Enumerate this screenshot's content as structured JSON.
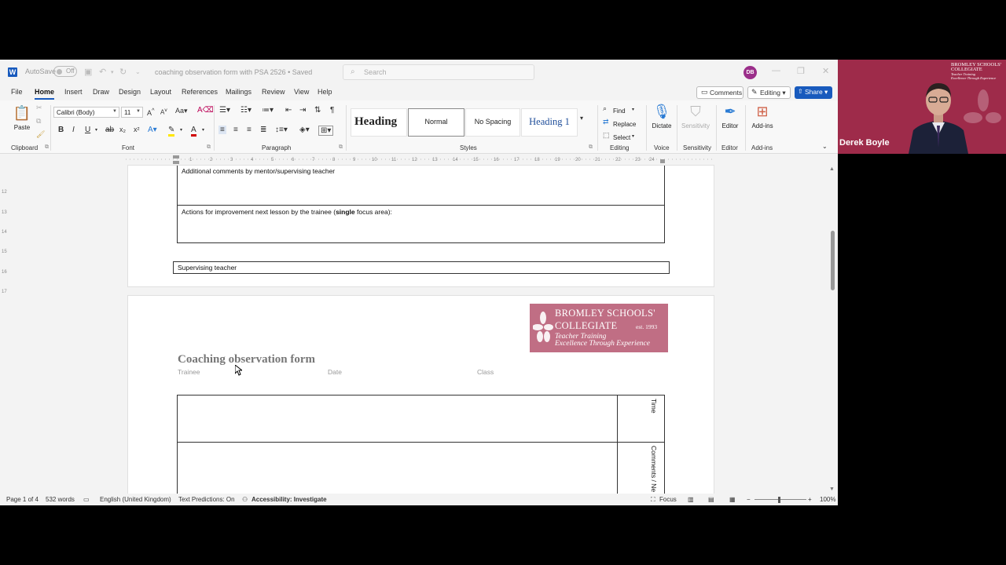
{
  "window": {
    "autosave_label": "AutoSave",
    "autosave_state": "Off",
    "doc_title": "coaching observation form with PSA 2526 • Saved",
    "search_placeholder": "Search",
    "avatar_initials": "DB"
  },
  "menu": {
    "tabs": [
      "File",
      "Home",
      "Insert",
      "Draw",
      "Design",
      "Layout",
      "References",
      "Mailings",
      "Review",
      "View",
      "Help"
    ],
    "active": "Home",
    "comments_label": "Comments",
    "editing_label": "Editing",
    "share_label": "Share"
  },
  "ribbon": {
    "clipboard": {
      "paste_label": "Paste",
      "group_label": "Clipboard"
    },
    "font": {
      "family": "Calibri (Body)",
      "size": "11",
      "group_label": "Font"
    },
    "paragraph": {
      "group_label": "Paragraph"
    },
    "styles": {
      "items": [
        "Heading",
        "Normal",
        "No Spacing",
        "Heading 1"
      ],
      "group_label": "Styles"
    },
    "editing": {
      "find": "Find",
      "replace": "Replace",
      "select": "Select",
      "group_label": "Editing"
    },
    "voice": {
      "dictate": "Dictate",
      "group_label": "Voice"
    },
    "sensitivity": {
      "label": "Sensitivity",
      "group_label": "Sensitivity"
    },
    "editor": {
      "label": "Editor",
      "group_label": "Editor"
    },
    "addins": {
      "label": "Add-ins",
      "group_label": "Add-ins"
    }
  },
  "ruler_ticks": [
    "1",
    "2",
    "3",
    "4",
    "5",
    "6",
    "7",
    "8",
    "9",
    "10",
    "11",
    "12",
    "13",
    "14",
    "15",
    "16",
    "17",
    "18",
    "19",
    "20",
    "21",
    "22",
    "23",
    "24"
  ],
  "vruler_ticks": [
    "12",
    "13",
    "14",
    "15",
    "16",
    "17"
  ],
  "document": {
    "page1": {
      "additional_comments": "Additional comments by mentor/supervising teacher",
      "actions_prefix": "Actions for improvement next lesson by the trainee (",
      "actions_bold": "single",
      "actions_suffix": " focus area):",
      "supervising_teacher": "Supervising teacher"
    },
    "page2": {
      "logo": {
        "line1": "BROMLEY SCHOOLS'",
        "line2": "COLLEGIATE",
        "est": "est. 1993",
        "line3": "Teacher Training",
        "line4": "Excellence Through Experience"
      },
      "form_title": "Coaching observation form",
      "fields": [
        "Trainee",
        "Date",
        "Class"
      ],
      "time_label": "Time",
      "comments_label": "Comments / Ne"
    }
  },
  "status": {
    "page": "Page 1 of 4",
    "words": "532 words",
    "language": "English (United Kingdom)",
    "predictions": "Text Predictions: On",
    "accessibility": "Accessibility: Investigate",
    "focus": "Focus",
    "zoom": "100%"
  },
  "video": {
    "participant_name": "Derek Boyle",
    "logo_lines": [
      "BROMLEY SCHOOLS'",
      "COLLEGIATE",
      "Teacher Training",
      "Excellence Through Experience"
    ]
  },
  "colors": {
    "word_blue": "#185abd",
    "logo_pink": "#c06e84",
    "video_bg": "#9e2b4a",
    "avatar_purple": "#9b2f8a"
  }
}
